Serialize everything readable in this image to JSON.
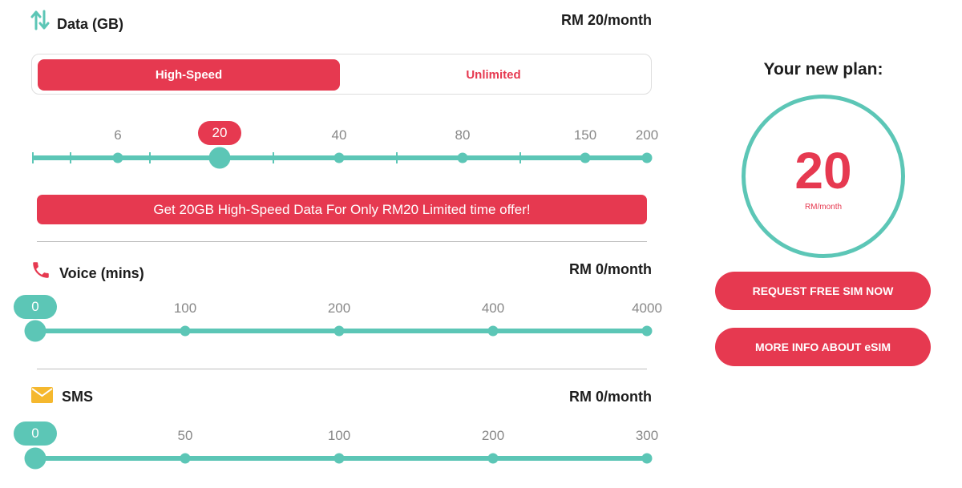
{
  "data_section": {
    "title": "Data (GB)",
    "price": "RM 20/month",
    "toggle": {
      "active": "High-Speed",
      "inactive": "Unlimited"
    },
    "selected_value": "20",
    "ticks": [
      "6",
      "40",
      "80",
      "150",
      "200"
    ],
    "offer": "Get 20GB High-Speed Data For Only RM20 Limited time offer!"
  },
  "voice_section": {
    "title": "Voice (mins)",
    "price": "RM 0/month",
    "selected_value": "0",
    "ticks": [
      "100",
      "200",
      "400",
      "4000"
    ]
  },
  "sms_section": {
    "title": "SMS",
    "price": "RM 0/month",
    "selected_value": "0",
    "ticks": [
      "50",
      "100",
      "200",
      "300"
    ]
  },
  "plan": {
    "title": "Your new plan:",
    "amount": "20",
    "unit": "RM/month"
  },
  "buttons": {
    "request_sim": "REQUEST FREE SIM NOW",
    "esim_info": "MORE INFO ABOUT eSIM"
  },
  "colors": {
    "accent": "#e63950",
    "teal": "#5cc6b6",
    "icon_yellow": "#f5b82e"
  }
}
